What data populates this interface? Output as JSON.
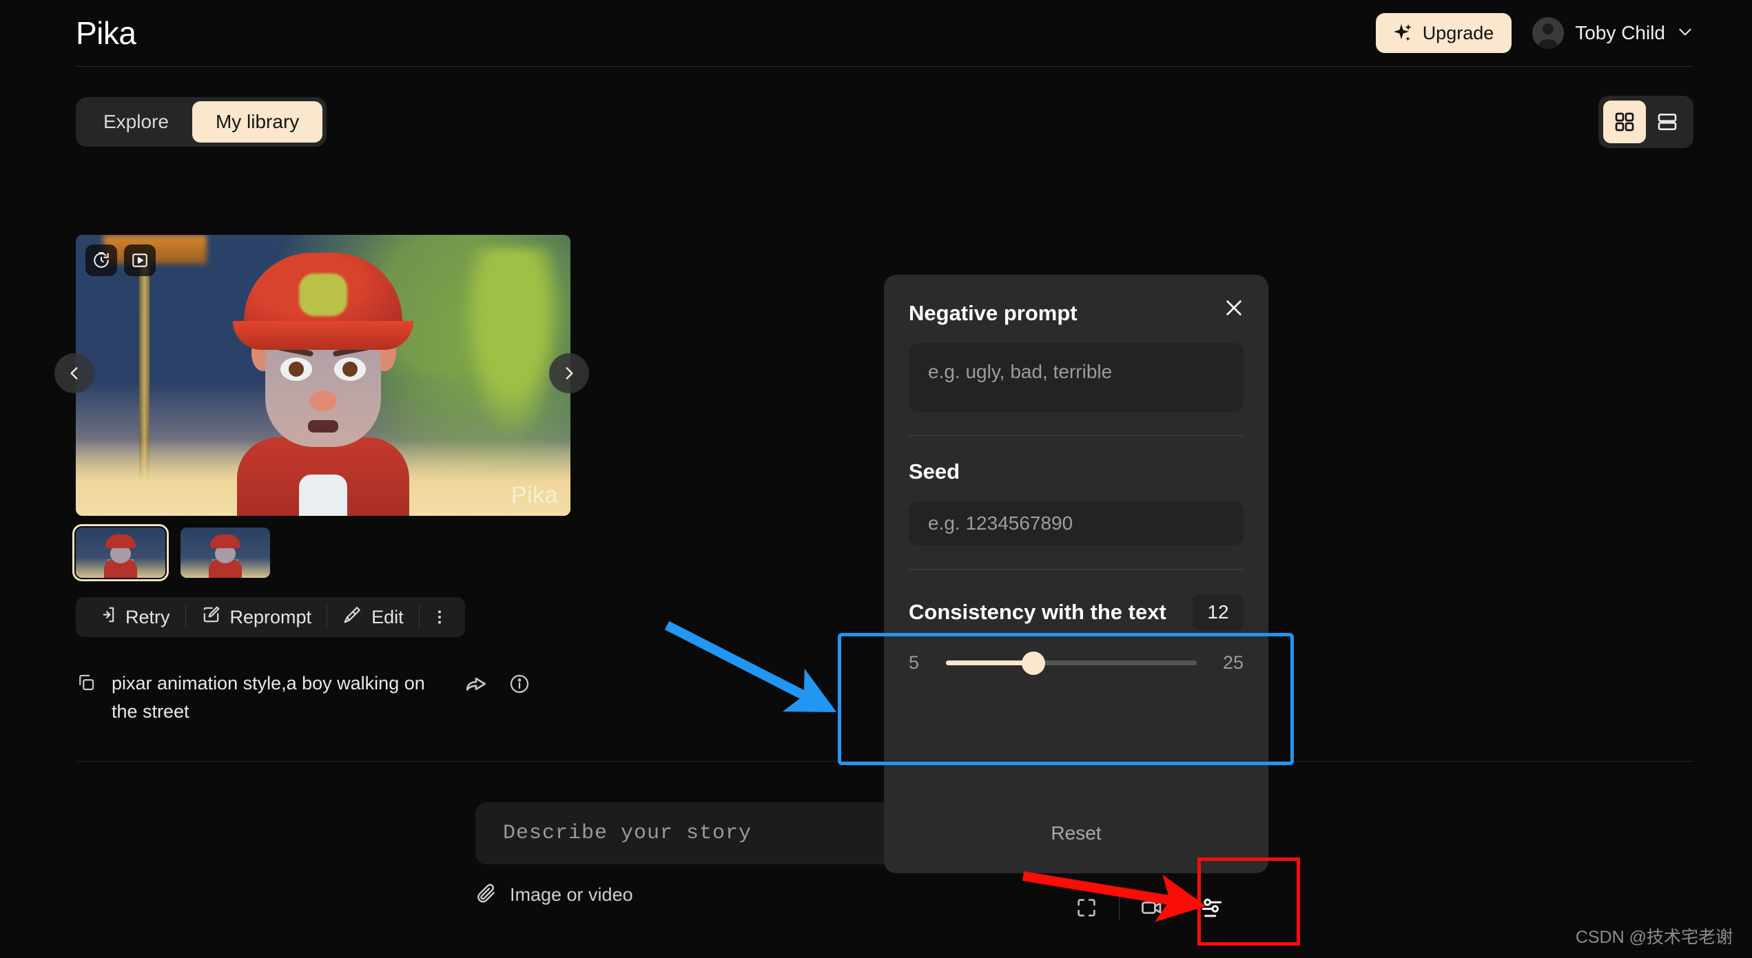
{
  "app": {
    "logo": "Pika"
  },
  "topbar": {
    "upgrade_label": "Upgrade",
    "upgrade_icon": "sparkle-icon",
    "user_name": "Toby Child",
    "chevron_icon": "chevron-down-icon",
    "avatar_icon": "avatar-icon"
  },
  "tabs": {
    "items": [
      {
        "label": "Explore",
        "active": false
      },
      {
        "label": "My library",
        "active": true
      }
    ]
  },
  "view_toggle": {
    "grid_icon": "grid-view-icon",
    "list_icon": "list-view-icon",
    "active": "grid"
  },
  "video_card": {
    "badges": [
      {
        "icon": "timer-restore-icon"
      },
      {
        "icon": "play-frame-icon"
      }
    ],
    "watermark": "Pika",
    "prev_icon": "chevron-left-icon",
    "next_icon": "chevron-right-icon"
  },
  "thumbnails": [
    {
      "selected": true
    },
    {
      "selected": false
    }
  ],
  "action_bar": {
    "items": [
      {
        "label": "Retry",
        "icon": "retry-icon"
      },
      {
        "label": "Reprompt",
        "icon": "reprompt-pencil-icon"
      },
      {
        "label": "Edit",
        "icon": "edit-brush-icon"
      }
    ],
    "kebab_icon": "more-vertical-icon"
  },
  "prompt": {
    "copy_icon": "copy-icon",
    "text": "pixar animation style,a boy walking on the street",
    "share_icon": "share-icon",
    "info_icon": "info-icon"
  },
  "composer": {
    "placeholder": "Describe your story",
    "attach_label": "Image or video",
    "attach_icon": "paperclip-icon"
  },
  "bottom_tools": {
    "aspect_icon": "aspect-ratio-icon",
    "video_icon": "video-camera-icon",
    "settings_icon": "sliders-settings-icon"
  },
  "settings_panel": {
    "close_icon": "close-icon",
    "negative_prompt": {
      "label": "Negative prompt",
      "placeholder": "e.g. ugly, bad, terrible",
      "value": ""
    },
    "seed": {
      "label": "Seed",
      "placeholder": "e.g. 1234567890",
      "value": ""
    },
    "consistency": {
      "label": "Consistency with the text",
      "value": "12",
      "min": "5",
      "max": "25",
      "percent": 35
    },
    "reset_label": "Reset"
  },
  "annotations": {
    "blue_color": "#2196f3",
    "red_color": "#fa0c07",
    "blue_arrow_target": "consistency-slider",
    "red_arrow_target": "settings-icon"
  },
  "watermark": "CSDN @技术宅老谢"
}
